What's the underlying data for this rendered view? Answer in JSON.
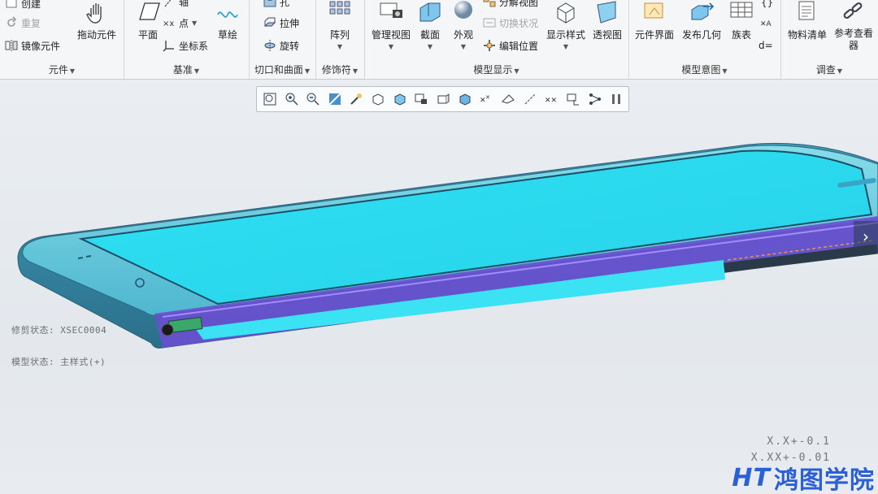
{
  "ribbon": {
    "groups": {
      "component": {
        "label": "元件",
        "items": {
          "create": "创建",
          "redo": "重复",
          "mirror": "镜像元件",
          "drag": "拖动元件"
        }
      },
      "datum": {
        "label": "基准",
        "items": {
          "plane": "平面",
          "axis": "轴",
          "point": "点",
          "csys": "坐标系",
          "sketch": "草绘"
        }
      },
      "cut_surface": {
        "label": "切口和曲面",
        "items": {
          "hole": "孔",
          "extrude": "拉伸",
          "revolve": "旋转"
        }
      },
      "modifier": {
        "label": "修饰符",
        "items": {
          "pattern": "阵列"
        }
      },
      "model_display": {
        "label": "模型显示",
        "items": {
          "manage_views": "管理视图",
          "section": "截面",
          "appearance": "外观",
          "exploded_view": "分解视图",
          "toggle_status": "切换状况",
          "edit_position": "编辑位置",
          "display_style": "显示样式",
          "perspective": "透视图"
        }
      },
      "model_intent": {
        "label": "模型意图",
        "items": {
          "component_interface": "元件界面",
          "publish_geometry": "发布几何",
          "family_table": "族表",
          "relations": "d="
        }
      },
      "investigate": {
        "label": "调查",
        "items": {
          "bom": "物料清单",
          "reference_viewer": "参考查看器"
        }
      }
    }
  },
  "view_toolbar": {
    "icons": [
      "refit-icon",
      "zoom-in-icon",
      "zoom-out-icon",
      "repaint-icon",
      "spin-center-icon",
      "display-style-icon",
      "saved-views-icon",
      "view-manager-icon",
      "named-views-icon",
      "perspective-icon",
      "datum-display-icon",
      "annotation-display-icon",
      "axis-display-icon",
      "point-display-icon",
      "csys-display-icon",
      "spin-icon",
      "pause-icon"
    ]
  },
  "status": {
    "section_state": "修剪状态: XSEC0004",
    "simp_rep": "模型状态: 主样式(+)"
  },
  "tolerance": {
    "line1": "X.X+-0.1",
    "line2": "X.XX+-0.01"
  },
  "watermark": {
    "logo": "HT",
    "text": "鸿图学院"
  },
  "colors": {
    "screen": "#31e6f6",
    "frame": "#3a8fb8",
    "section": "#6a4fd0"
  }
}
